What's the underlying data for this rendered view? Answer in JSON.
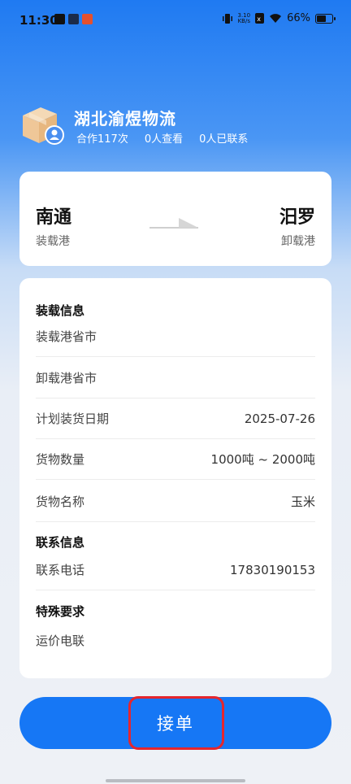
{
  "status_bar": {
    "time": "11:30",
    "network_speed_value": "3.10",
    "network_speed_unit": "KB/s",
    "battery": "66%",
    "battery_level": 0.66
  },
  "company": {
    "name": "湖北渝煜物流",
    "cooperations": "合作117次",
    "views": "0人查看",
    "contacted": "0人已联系"
  },
  "route": {
    "origin": "南通",
    "origin_label": "装载港",
    "destination": "汨罗",
    "destination_label": "卸载港"
  },
  "load_info": {
    "section_title": "装载信息",
    "fields": [
      {
        "label": "装载港省市",
        "value": ""
      },
      {
        "label": "卸载港省市",
        "value": ""
      },
      {
        "label": "计划装货日期",
        "value": "2025-07-26"
      },
      {
        "label": "货物数量",
        "value": "1000吨 ~ 2000吨"
      },
      {
        "label": "货物名称",
        "value": "玉米"
      }
    ]
  },
  "contact_info": {
    "section_title": "联系信息",
    "phone_label": "联系电话",
    "phone_value": "17830190153"
  },
  "special": {
    "section_title": "特殊要求",
    "text": "运价电联"
  },
  "action": {
    "accept_label": "接单"
  },
  "colors": {
    "primary": "#1677f5",
    "highlight": "#e5262d"
  }
}
